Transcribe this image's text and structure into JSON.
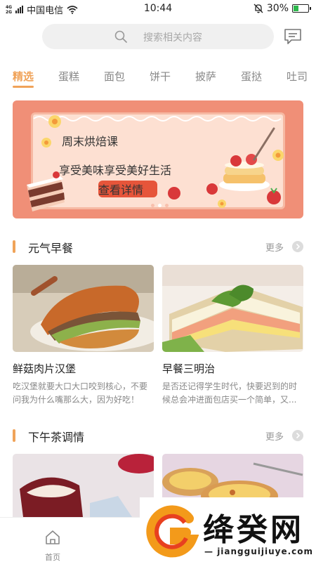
{
  "status_bar": {
    "signal_top": "4G",
    "signal_bottom": "2G",
    "carrier": "中国电信",
    "time": "10:44",
    "battery_text": "30%",
    "battery_level": 0.3
  },
  "search": {
    "placeholder": "搜索相关内容",
    "icon": "search-icon"
  },
  "message_icon": "message-icon",
  "tabs": [
    {
      "label": "精选",
      "active": true
    },
    {
      "label": "蛋糕"
    },
    {
      "label": "面包"
    },
    {
      "label": "饼干"
    },
    {
      "label": "披萨"
    },
    {
      "label": "蛋挞"
    },
    {
      "label": "吐司"
    }
  ],
  "banner": {
    "title": "周末烘焙课",
    "subtitle": "享受美味享受美好生活",
    "cta": "查看详情"
  },
  "sections": [
    {
      "title": "元气早餐",
      "more": "更多",
      "cards": [
        {
          "name": "鲜菇肉片汉堡",
          "desc_line1": "吃汉堡就要大口大口咬到核心，不要",
          "desc_line2": "问我为什么嘴那么大，因为好吃！"
        },
        {
          "name": "早餐三明治",
          "desc_line1": "是否还记得学生时代，快要迟到的时",
          "desc_line2": "候总会冲进面包店买一个简单，又..."
        }
      ]
    },
    {
      "title": "下午茶调情",
      "more": "更多"
    }
  ],
  "bottom_nav": {
    "home_label": "首页"
  },
  "watermark": {
    "text": "绛癸网",
    "url": "jiangguijiuye.com"
  },
  "colors": {
    "accent": "#f0a359",
    "banner_bg": "#f08f77",
    "banner_text": "#e44f34"
  }
}
